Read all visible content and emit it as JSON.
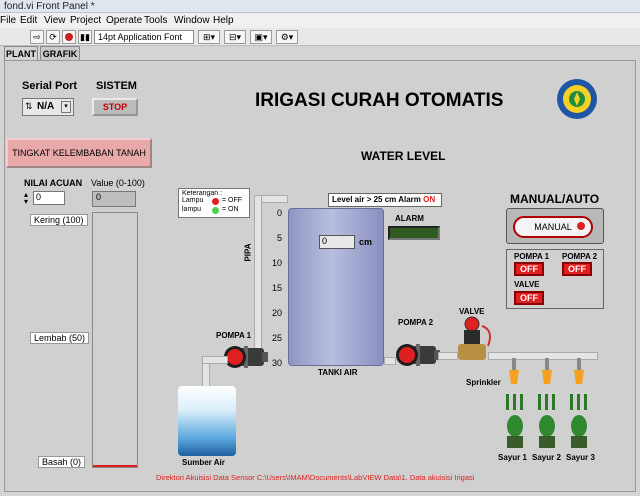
{
  "window": {
    "title": "fond.vi Front Panel *"
  },
  "menu": [
    "File",
    "Edit",
    "View",
    "Project",
    "Operate",
    "Tools",
    "Window",
    "Help"
  ],
  "toolbar": {
    "font_select": "14pt Application Font"
  },
  "tabs": [
    {
      "label": "PLANT",
      "active": true
    },
    {
      "label": "GRAFIK",
      "active": false
    }
  ],
  "serial": {
    "label": "Serial Port",
    "value": "N/A"
  },
  "sistem": {
    "label": "SISTEM",
    "stop_label": "STOP"
  },
  "title": "IRIGASI CURAH OTOMATIS",
  "kelembaban": {
    "button_label": "TINGKAT KELEMBABAN TANAH"
  },
  "nilai_acuan": {
    "label": "NILAI ACUAN",
    "value": "0"
  },
  "value_range": {
    "label": "Value (0-100)",
    "value": "0"
  },
  "moisture_scale": [
    "Kering (100)",
    "Lembab (50)",
    "Basah (0)"
  ],
  "water_level": {
    "label": "WATER LEVEL",
    "ticks": [
      "0",
      "5",
      "10",
      "15",
      "20",
      "25",
      "30"
    ],
    "value": "0",
    "unit": "cm"
  },
  "keterangan": {
    "title": "Keterangan :",
    "row1": "Lampu",
    "row1_state": "= OFF",
    "row2": "lampu",
    "row2_state": "= ON"
  },
  "alarm": {
    "level_text": "Level air > 25 cm  Alarm",
    "state": "ON",
    "label": "ALARM"
  },
  "labels": {
    "pipa": "PIPA",
    "tanki": "TANKI AIR",
    "pompa1": "POMPA 1",
    "pompa2": "POMPA  2",
    "valve": "VALVE",
    "sprinkler": "Sprinkler",
    "sumber": "Sumber Air"
  },
  "manual_auto": {
    "label": "MANUAL/AUTO",
    "button": "MANUAL"
  },
  "indicators": [
    {
      "name": "POMPA 1",
      "state": "OFF"
    },
    {
      "name": "POMPA 2",
      "state": "OFF"
    },
    {
      "name": "VALVE",
      "state": "OFF"
    }
  ],
  "sayur": [
    "Sayur 1",
    "Sayur 2",
    "Sayur 3"
  ],
  "footer_path": "Direktori Akuisisi Data Sensor C:\\Users\\IMAM\\Documents\\LabVIEW Data\\1. Data akuisisi Irigasi",
  "colors": {
    "accent_red": "#e02020",
    "led_green": "#2f6b20",
    "panel": "#d0d0d0"
  }
}
